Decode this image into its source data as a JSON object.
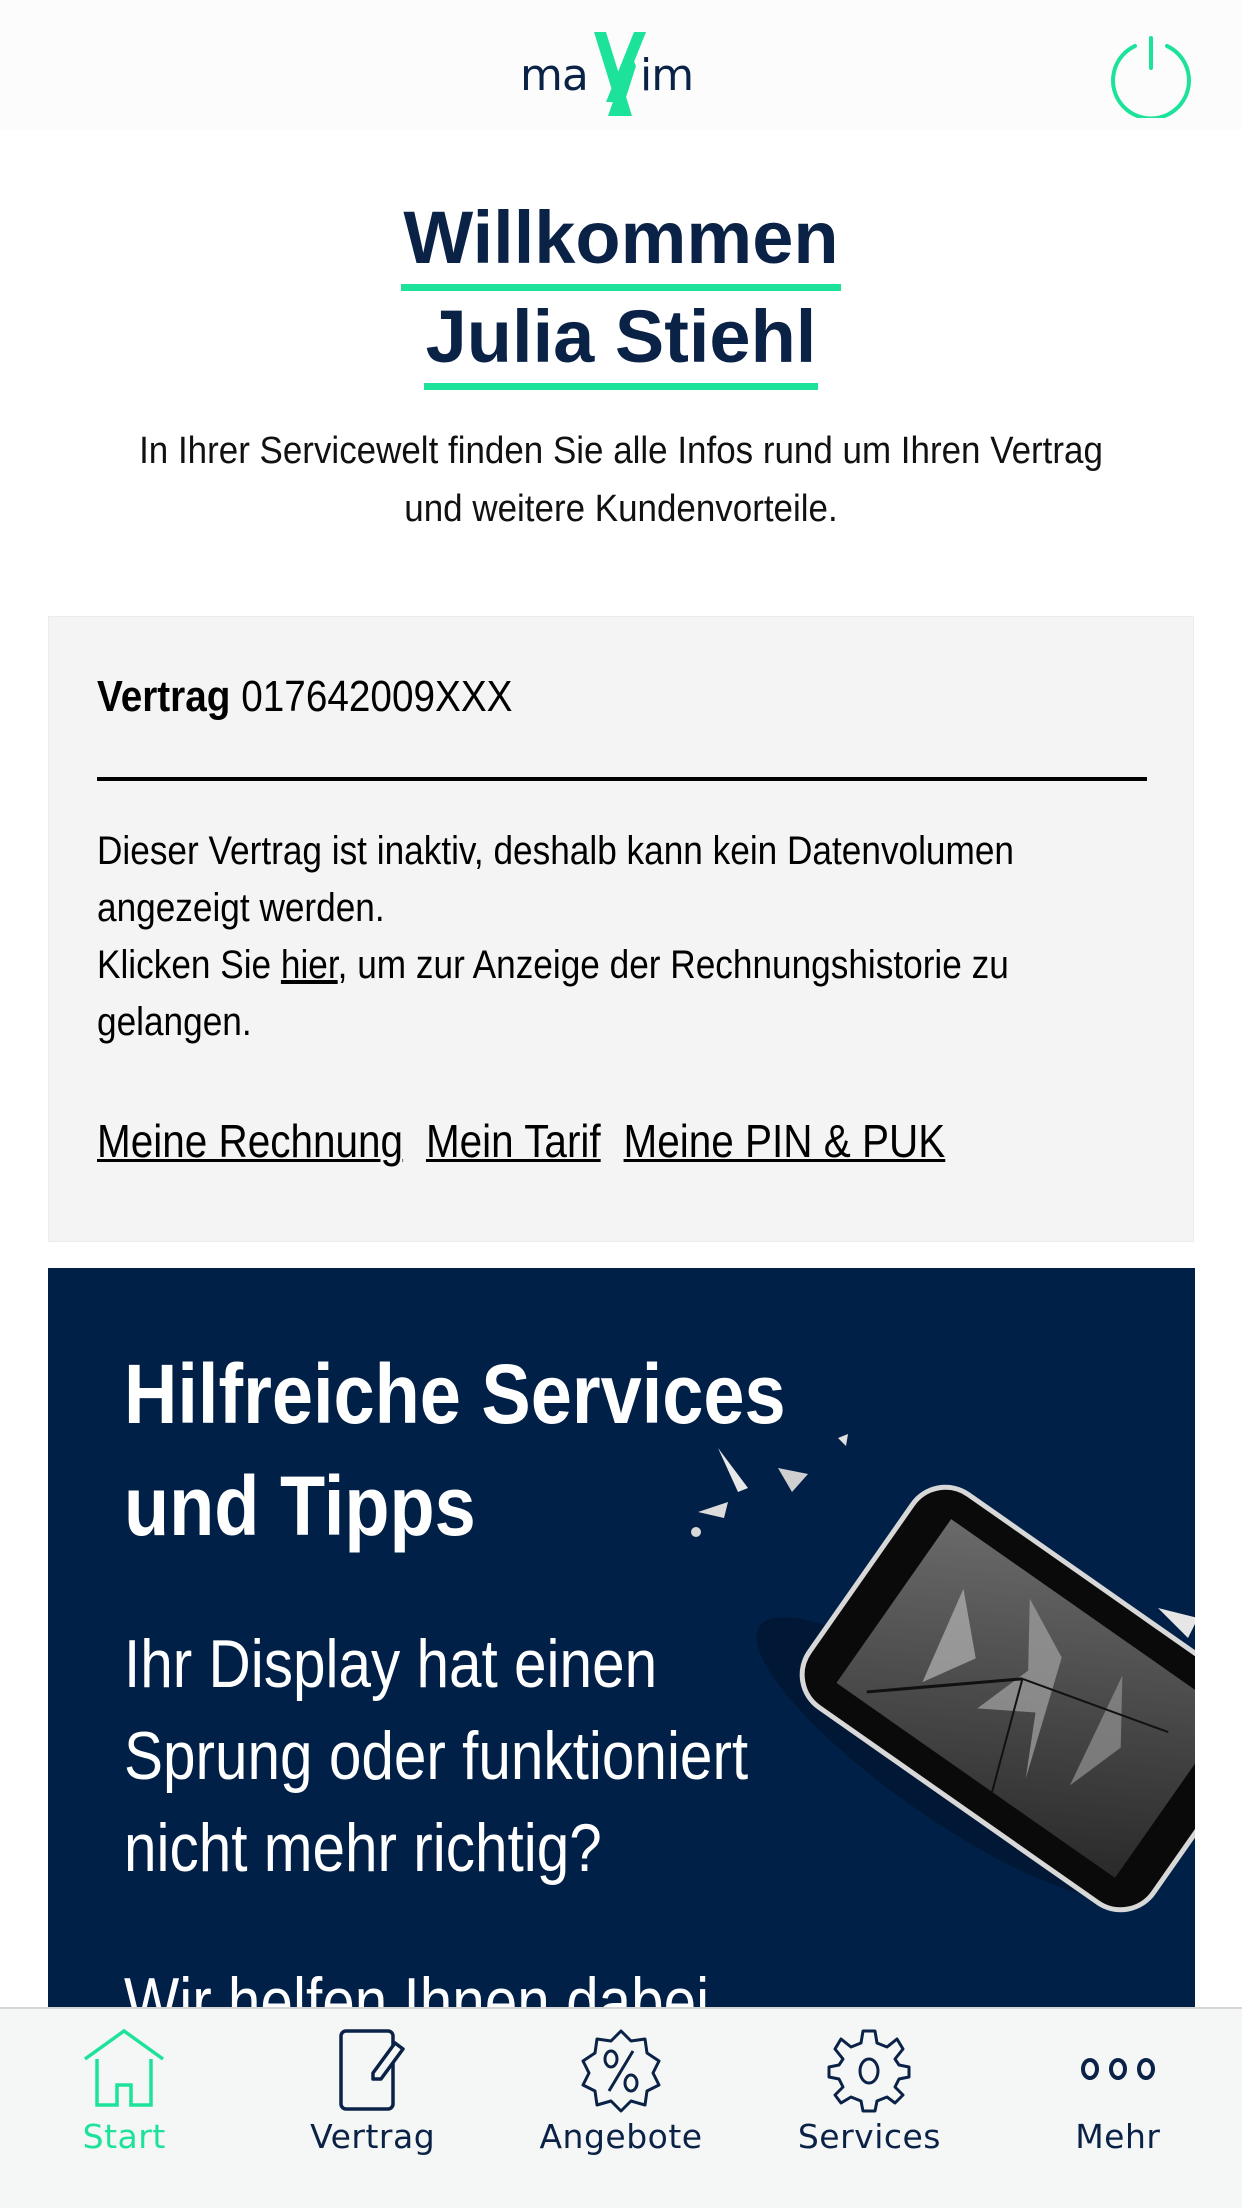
{
  "header": {
    "logo_left": "ma",
    "logo_right": "im",
    "logo_alt": "maXXim",
    "power_button_label": "Abmelden"
  },
  "welcome": {
    "line1": "Willkommen",
    "line2": "Julia Stiehl"
  },
  "intro": {
    "line1": "In Ihrer Servicewelt finden Sie alle Infos rund um Ihren Vertrag",
    "line2": "und weitere Kundenvorteile."
  },
  "contract_card": {
    "label": "Vertrag",
    "number": "017642009XXX",
    "message_line1": "Dieser Vertrag ist inaktiv, deshalb kann kein Datenvolumen",
    "message_line2": "angezeigt werden.",
    "message_prefix": "Klicken Sie ",
    "message_link": "hier",
    "message_suffix": ", um zur Anzeige der Rechnungshistorie zu",
    "message_line4": "gelangen.",
    "links": [
      "Meine Rechnung",
      "Mein Tarif",
      "Meine PIN & PUK"
    ]
  },
  "banner": {
    "headline_line1": "Hilfreiche Services",
    "headline_line2": "und Tipps",
    "text_line1": "Ihr Display hat einen",
    "text_line2": "Sprung oder funktioniert",
    "text_line3": "nicht mehr richtig?",
    "text_line4": "Wir helfen Ihnen dabei"
  },
  "tabbar": {
    "items": [
      {
        "label": "Start",
        "icon": "home-icon",
        "active": true
      },
      {
        "label": "Vertrag",
        "icon": "contract-edit-icon",
        "active": false
      },
      {
        "label": "Angebote",
        "icon": "percent-badge-icon",
        "active": false
      },
      {
        "label": "Services",
        "icon": "gear-icon",
        "active": false
      },
      {
        "label": "Mehr",
        "icon": "more-dots-icon",
        "active": false
      }
    ]
  },
  "colors": {
    "accent": "#1de39a",
    "navy": "#0b2247",
    "banner_bg": "#012047",
    "card_bg": "#f4f4f4",
    "tabbar_bg": "#f5f6f6"
  }
}
